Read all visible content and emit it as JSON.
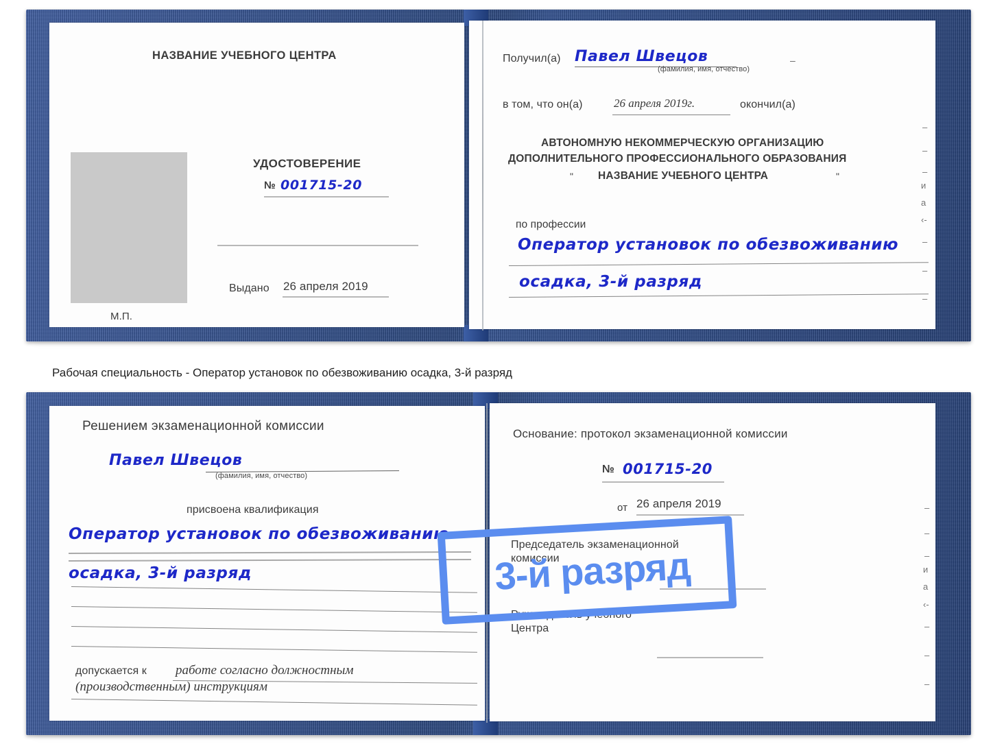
{
  "caption": "Рабочая специальность - Оператор установок по обезвоживанию осадка, 3-й разряд",
  "watermark": {
    "label": "3-й разряд",
    "color": "#5b8def"
  },
  "colors": {
    "cover": "#2b4c92",
    "handwriting": "#1d28c8",
    "page": "#fdfdfd",
    "photo_placeholder": "#c9c9c9",
    "rule": "#6f6f6f"
  },
  "certificate_top": {
    "left_page": {
      "org_title": "НАЗВАНИЕ УЧЕБНОГО ЦЕНТРА",
      "doc_title": "УДОСТОВЕРЕНИЕ",
      "number_label": "№",
      "number_value": "001715-20",
      "issued_label": "Выдано",
      "issued_value": "26 апреля 2019",
      "stamp_label": "М.П."
    },
    "right_page": {
      "received_label": "Получил(а)",
      "received_value": "Павел Швецов",
      "fio_hint": "(фамилия, имя, отчество)",
      "in_that_label": "в том, что он(а)",
      "in_that_value": "26 апреля 2019г.",
      "finished_label": "окончил(а)",
      "org_line1": "АВТОНОМНУЮ НЕКОММЕРЧЕСКУЮ ОРГАНИЗАЦИЮ",
      "org_line2": "ДОПОЛНИТЕЛЬНОГО ПРОФЕССИОНАЛЬНОГО ОБРАЗОВАНИЯ",
      "org_quote_open": "\"",
      "org_line3": "НАЗВАНИЕ УЧЕБНОГО ЦЕНТРА",
      "org_quote_close": "\"",
      "profession_label": "по профессии",
      "profession_line1": "Оператор установок по обезвоживанию",
      "profession_line2": "осадка, 3-й разряд",
      "edge_fragments": [
        "–",
        "–",
        "–",
        "и",
        "а",
        "‹-",
        "–",
        "–",
        "–"
      ]
    }
  },
  "certificate_bottom": {
    "left_page": {
      "heading": "Решением экзаменационной комиссии",
      "name_value": "Павел Швецов",
      "fio_hint": "(фамилия, имя, отчество)",
      "qualification_label": "присвоена квалификация",
      "qualification_line1": "Оператор установок по обезвоживанию",
      "qualification_line2": "осадка, 3-й разряд",
      "admitted_label": "допускается к",
      "admitted_line1": "работе согласно должностным",
      "admitted_line2": "(производственным) инструкциям"
    },
    "right_page": {
      "basis_label": "Основание: протокол экзаменационной комиссии",
      "number_label": "№",
      "number_value": "001715-20",
      "date_label": "от",
      "date_value": "26 апреля 2019",
      "chairman_line1": "Председатель экзаменационной",
      "chairman_line2": "комиссии",
      "head_line1": "Руководитель учебного",
      "head_line2": "Центра",
      "edge_fragments": [
        "–",
        "–",
        "–",
        "и",
        "а",
        "‹-",
        "–",
        "–",
        "–"
      ]
    }
  }
}
